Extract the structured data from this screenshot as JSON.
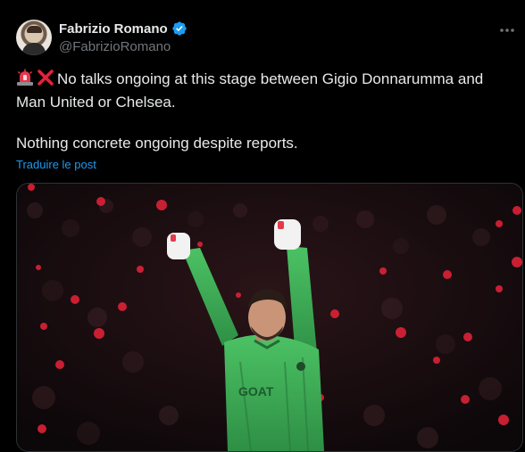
{
  "author": {
    "display_name": "Fabrizio Romano",
    "handle": "@FabrizioRomano",
    "verified_color": "#1d9bf0"
  },
  "tweet": {
    "emojis": [
      "siren-emoji",
      "cross-mark-emoji"
    ],
    "line1": "No talks ongoing at this stage between Gigio Donnarumma and Man United or Chelsea.",
    "line2": "Nothing concrete ongoing despite reports.",
    "translate_label": "Traduire le post"
  },
  "media": {
    "description_icon": "photo-icon",
    "shirt_text": "GOAT"
  },
  "colors": {
    "background": "#000000",
    "text": "#e7e9ea",
    "secondary": "#71767b",
    "link": "#1d9bf0",
    "keeper_kit": "#3fb55a"
  }
}
